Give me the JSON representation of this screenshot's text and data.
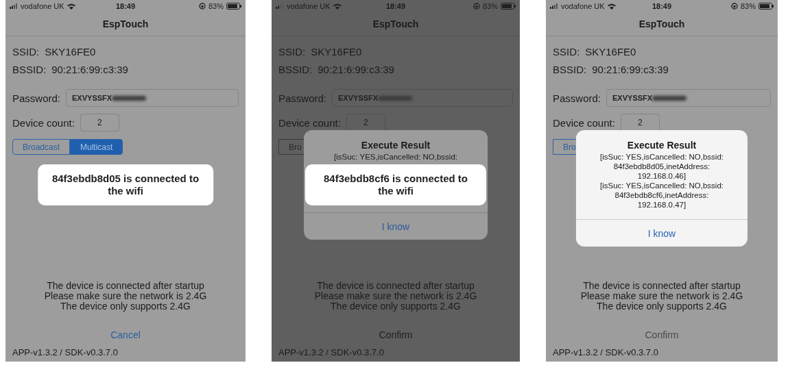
{
  "screens": [
    {
      "dimmed": false,
      "status_bar": {
        "carrier": "vodafone UK",
        "time": "18:49",
        "battery": "83%"
      },
      "nav_title": "EspTouch",
      "ssid": {
        "label": "SSID:",
        "value": "SKY16FE0"
      },
      "bssid": {
        "label": "BSSID:",
        "value": "90:21:6:99:c3:39"
      },
      "password": {
        "label": "Password:",
        "value": "EXVYSSFX"
      },
      "device_count": {
        "label": "Device count:",
        "value": "2"
      },
      "mode_segments": [
        {
          "label": "Broadcast",
          "selected": false
        },
        {
          "label": "Multicast",
          "selected": true
        }
      ],
      "notes": [
        "The device is connected after startup",
        "Please make sure the network is 2.4G",
        "The device only supports 2.4G"
      ],
      "action_button": {
        "label": "Cancel",
        "disabled": false
      },
      "version": "APP-v1.3.2 / SDK-v0.3.7.0",
      "toast": "84f3ebdb8d05 is connected to the wifi"
    },
    {
      "dimmed": true,
      "status_bar": {
        "carrier": "vodafone UK",
        "time": "18:49",
        "battery": "83%"
      },
      "nav_title": "EspTouch",
      "ssid": {
        "label": "SSID:",
        "value": "SKY16FE0"
      },
      "bssid": {
        "label": "BSSID:",
        "value": "90:21:6:99:c3:39"
      },
      "password": {
        "label": "Password:",
        "value": "EXVYSSFX"
      },
      "device_count": {
        "label": "Device count:",
        "value": "2"
      },
      "mode_segments": [
        {
          "label": "Bro",
          "selected": false
        }
      ],
      "notes": [
        "The device is connected after startup",
        "Please make sure the network is 2.4G",
        "The device only supports 2.4G"
      ],
      "action_button": {
        "label": "Confirm",
        "disabled": true
      },
      "version": "APP-v1.3.2 / SDK-v0.3.7.0",
      "dialog": {
        "title": "Execute Result",
        "message": [
          "[isSuc: YES,isCancelled: NO,bssid:"
        ],
        "button": "I know"
      },
      "toast": "84f3ebdb8cf6 is connected to the wifi"
    },
    {
      "dimmed": false,
      "status_bar": {
        "carrier": "vodafone UK",
        "time": "18:49",
        "battery": "83%"
      },
      "nav_title": "EspTouch",
      "ssid": {
        "label": "SSID:",
        "value": "SKY16FE0"
      },
      "bssid": {
        "label": "BSSID:",
        "value": "90:21:6:99:c3:39"
      },
      "password": {
        "label": "Password:",
        "value": "EXVYSSFX"
      },
      "device_count": {
        "label": "Device count:",
        "value": "2"
      },
      "mode_segments": [
        {
          "label": "Bro",
          "selected": false
        }
      ],
      "notes": [
        "The device is connected after startup",
        "Please make sure the network is 2.4G",
        "The device only supports 2.4G"
      ],
      "action_button": {
        "label": "Confirm",
        "disabled": true
      },
      "version": "APP-v1.3.2 / SDK-v0.3.7.0",
      "dialog": {
        "title": "Execute Result",
        "message": [
          "[isSuc: YES,isCancelled: NO,bssid:",
          "84f3ebdb8d05,inetAddress:",
          "192.168.0.46]",
          "[isSuc: YES,isCancelled: NO,bssid:",
          "84f3ebdb8cf6,inetAddress:",
          "192.168.0.47]"
        ],
        "button": "I know"
      }
    }
  ]
}
